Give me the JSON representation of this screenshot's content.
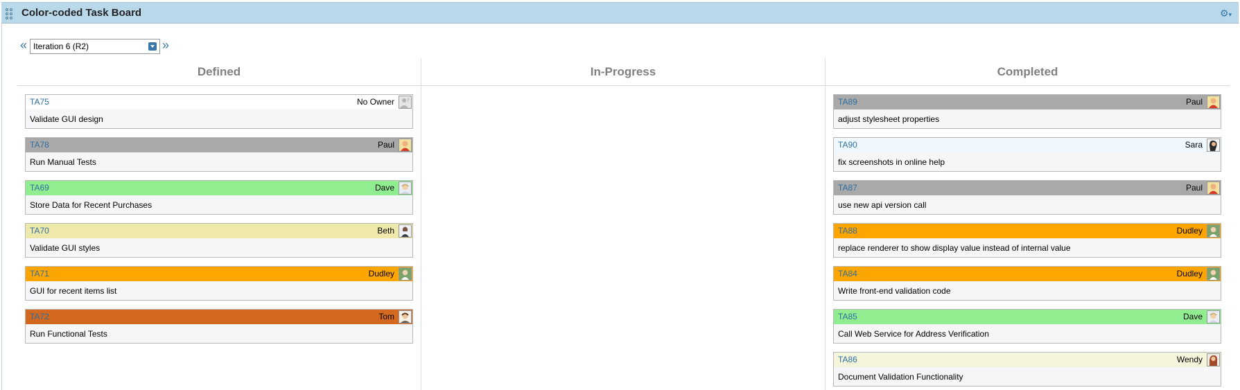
{
  "app": {
    "title": "Color-coded Task Board"
  },
  "iteration": {
    "selected": "Iteration 6 (R2)",
    "prev": "«",
    "next": "»"
  },
  "columns": [
    {
      "name": "Defined"
    },
    {
      "name": "In-Progress"
    },
    {
      "name": "Completed"
    }
  ],
  "cards": {
    "defined": [
      {
        "id": "TA75",
        "owner": "No Owner",
        "title": "Validate GUI design",
        "color": "#ffffff",
        "avatar": "no-owner"
      },
      {
        "id": "TA78",
        "owner": "Paul",
        "title": "Run Manual Tests",
        "color": "#a9a9a9",
        "avatar": "paul"
      },
      {
        "id": "TA69",
        "owner": "Dave",
        "title": "Store Data for Recent Purchases",
        "color": "#90ee90",
        "avatar": "dave"
      },
      {
        "id": "TA70",
        "owner": "Beth",
        "title": "Validate GUI styles",
        "color": "#eee8aa",
        "avatar": "beth"
      },
      {
        "id": "TA71",
        "owner": "Dudley",
        "title": "GUI for recent items list",
        "color": "#ffa500",
        "avatar": "dudley"
      },
      {
        "id": "TA72",
        "owner": "Tom",
        "title": "Run Functional Tests",
        "color": "#d2691e",
        "avatar": "tom"
      }
    ],
    "inprogress": [],
    "completed": [
      {
        "id": "TA89",
        "owner": "Paul",
        "title": "adjust stylesheet properties",
        "color": "#a9a9a9",
        "avatar": "paul"
      },
      {
        "id": "TA90",
        "owner": "Sara",
        "title": "fix screenshots in online help",
        "color": "#f0f8ff",
        "avatar": "sara"
      },
      {
        "id": "TA87",
        "owner": "Paul",
        "title": "use new api version call",
        "color": "#a9a9a9",
        "avatar": "paul"
      },
      {
        "id": "TA88",
        "owner": "Dudley",
        "title": "replace renderer to show display value instead of internal value",
        "color": "#ffa500",
        "avatar": "dudley"
      },
      {
        "id": "TA84",
        "owner": "Dudley",
        "title": "Write front-end validation code",
        "color": "#ffa500",
        "avatar": "dudley"
      },
      {
        "id": "TA85",
        "owner": "Dave",
        "title": "Call Web Service for Address Verification",
        "color": "#90ee90",
        "avatar": "dave"
      },
      {
        "id": "TA86",
        "owner": "Wendy",
        "title": "Document Validation Functionality",
        "color": "#f5f5dc",
        "avatar": "wendy"
      }
    ]
  }
}
